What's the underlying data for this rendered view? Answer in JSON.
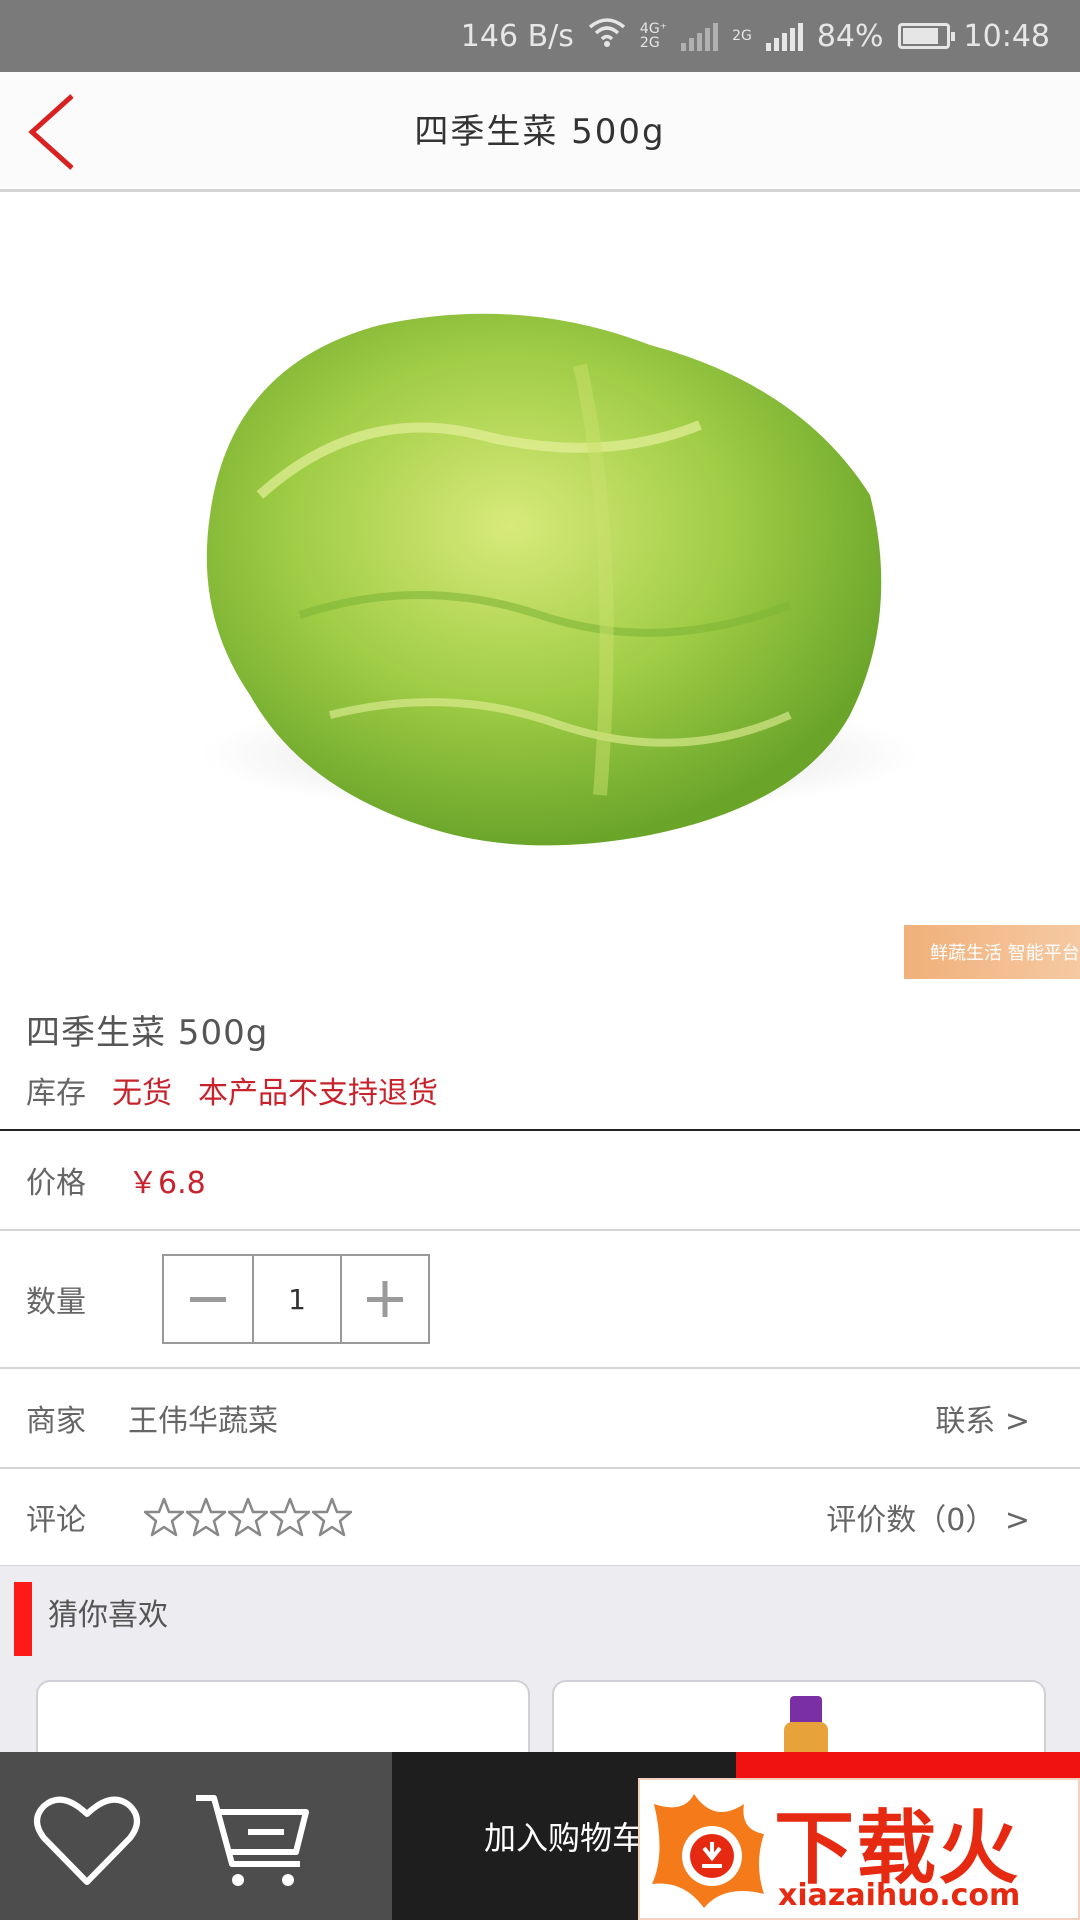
{
  "status_bar": {
    "net_speed": "146 B/s",
    "net_type_1": "4G⁺",
    "net_type_1b": "2G",
    "net_type_2": "2G",
    "battery": "84%",
    "time": "10:48",
    "battery_level": 0.84
  },
  "header": {
    "title": "四季生菜 500g"
  },
  "product": {
    "watermark": "鲜蔬生活 智能平台",
    "name": "四季生菜 500g",
    "stock_label": "库存",
    "stock_status": "无货",
    "return_policy": "本产品不支持退货"
  },
  "price": {
    "label": "价格",
    "value": "￥6.8"
  },
  "quantity": {
    "label": "数量",
    "value": "1"
  },
  "merchant": {
    "label": "商家",
    "name": "王伟华蔬菜",
    "contact": "联系  >"
  },
  "reviews": {
    "label": "评论",
    "stars": 0,
    "count_text": "评价数（0）  >"
  },
  "recommend": {
    "title": "猜你喜欢"
  },
  "bottom_bar": {
    "add_to_cart": "加入购物车"
  },
  "overlay": {
    "brand": "下载火",
    "url": "xiazaihuo.com"
  },
  "colors": {
    "accent_red": "#c8232c",
    "buy_red": "#f01111"
  }
}
